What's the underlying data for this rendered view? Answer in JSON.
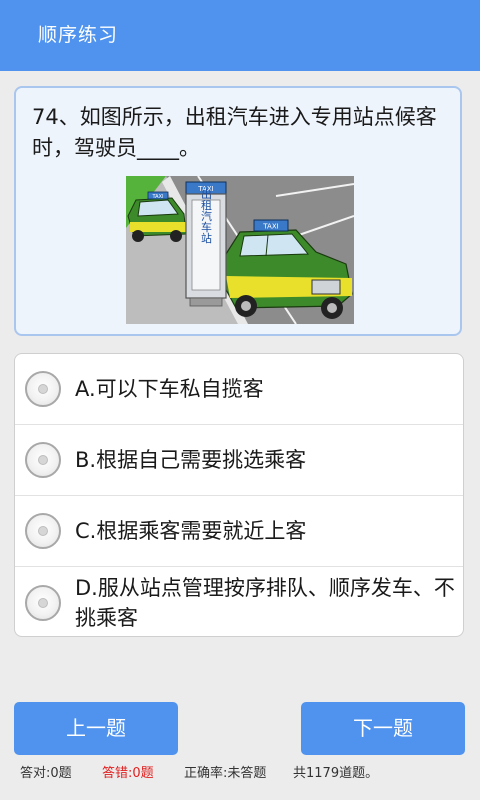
{
  "header": {
    "title": "顺序练习"
  },
  "question": {
    "text": "74、如图所示，出租汽车进入专用站点候客时，驾驶员____。",
    "image": {
      "sign_label": "TAXI",
      "station_text": "出租汽车站",
      "car_roof_label": "TAXI"
    }
  },
  "options": [
    {
      "label": "A.可以下车私自揽客"
    },
    {
      "label": "B.根据自己需要挑选乘客"
    },
    {
      "label": "C.根据乘客需要就近上客"
    },
    {
      "label": "D.服从站点管理按序排队、顺序发车、不挑乘客"
    }
  ],
  "nav": {
    "prev_label": "上一题",
    "next_label": "下一题"
  },
  "stats": {
    "correct": "答对:0题",
    "wrong": "答错:0题",
    "accuracy": "正确率:未答题",
    "total": "共1179道题。"
  },
  "colors": {
    "accent": "#4f93ee",
    "wrong": "#e02020"
  }
}
